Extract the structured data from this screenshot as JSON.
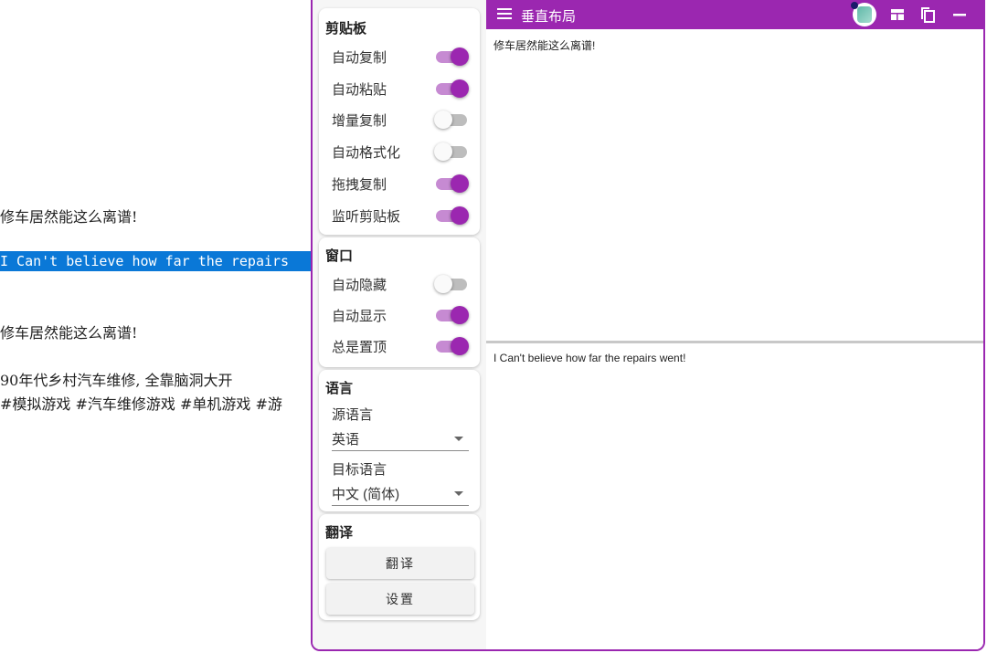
{
  "background_text": {
    "line1": "修车居然能这么离谱!",
    "line2_selected": "I Can't believe how far the repairs",
    "line3": "修车居然能这么离谱!",
    "line4": "90年代乡村汽车维修, 全靠脑洞大开",
    "line5": "#模拟游戏 #汽车维修游戏 #单机游戏 #游"
  },
  "app": {
    "title": "垂直布局",
    "icons": {
      "menu": "menu-icon",
      "avatar": "avatar-icon",
      "layout": "layout-icon",
      "copy": "copy-icon",
      "minimize": "minimize-icon"
    },
    "clipboard": {
      "title": "剪贴板",
      "items": [
        {
          "label": "自动复制",
          "on": true
        },
        {
          "label": "自动粘贴",
          "on": true
        },
        {
          "label": "增量复制",
          "on": false
        },
        {
          "label": "自动格式化",
          "on": false
        },
        {
          "label": "拖拽复制",
          "on": true
        },
        {
          "label": "监听剪贴板",
          "on": true
        }
      ]
    },
    "window": {
      "title": "窗口",
      "items": [
        {
          "label": "自动隐藏",
          "on": false
        },
        {
          "label": "自动显示",
          "on": true
        },
        {
          "label": "总是置顶",
          "on": true
        }
      ]
    },
    "language": {
      "title": "语言",
      "source_label": "源语言",
      "source_value": "英语",
      "target_label": "目标语言",
      "target_value": "中文 (简体)"
    },
    "translate": {
      "title": "翻译",
      "translate_button": "翻译",
      "settings_button": "设置"
    },
    "source_text": "修车居然能这么离谱!",
    "target_text": "I Can't believe how far the repairs went!",
    "colors": {
      "accent": "#9b27b0",
      "switch_track_on": "#c68ad2",
      "selection": "#0a78d7"
    }
  }
}
